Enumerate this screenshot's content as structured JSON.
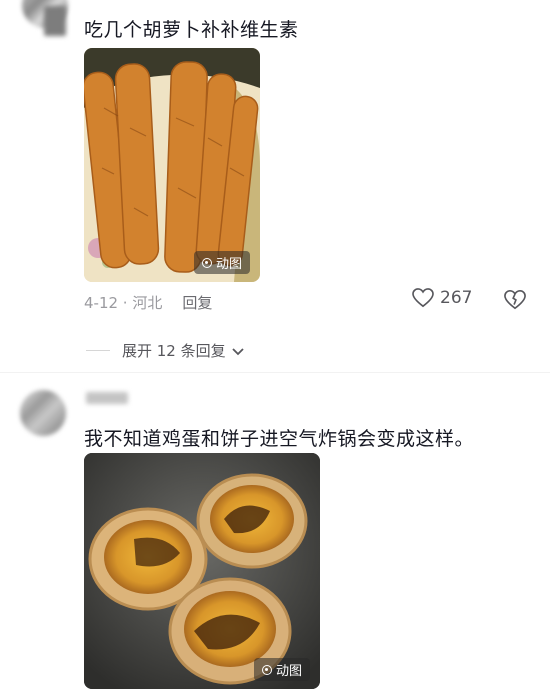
{
  "comment1": {
    "text": "吃几个胡萝卜补补维生素",
    "media_badge": "动图",
    "date_location": "4-12 · 河北",
    "reply_label": "回复",
    "likes": "267",
    "expand_label": "展开 12 条回复"
  },
  "comment2": {
    "text": "我不知道鸡蛋和饼子进空气炸锅会变成这样。",
    "media_badge": "动图"
  },
  "icons": {
    "like": "heart-outline-icon",
    "dislike": "broken-heart-icon",
    "expand": "chevron-down-icon",
    "badge": "live-photo-icon"
  }
}
